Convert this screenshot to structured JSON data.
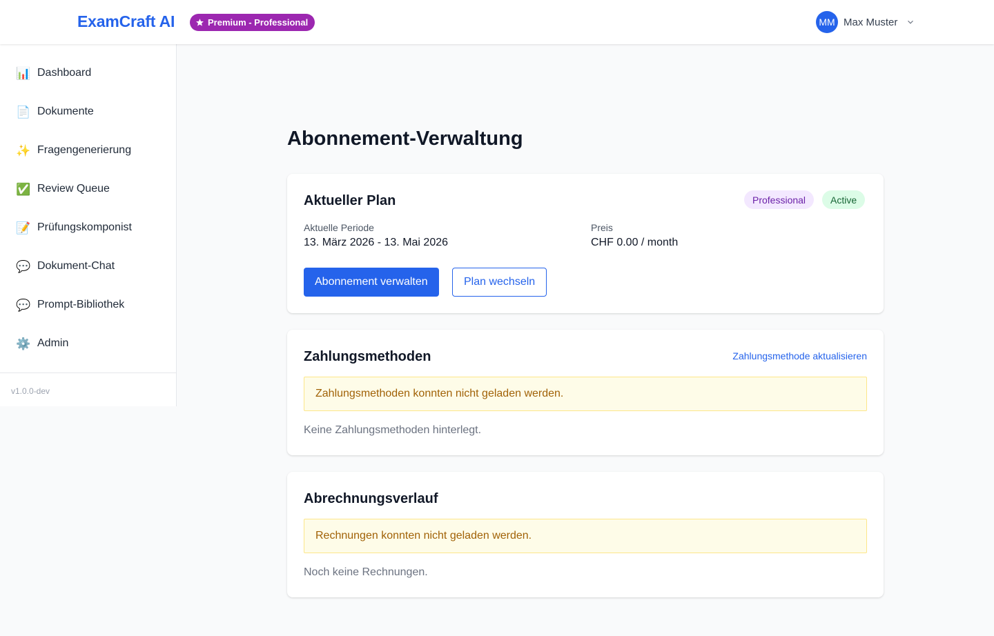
{
  "header": {
    "brand": "ExamCraft AI",
    "plan_badge": "Premium - Professional",
    "user": {
      "initials": "MM",
      "name": "Max Muster"
    }
  },
  "sidebar": {
    "items": [
      {
        "label": "Dashboard",
        "icon": "bar-chart-icon",
        "glyph": "📊"
      },
      {
        "label": "Dokumente",
        "icon": "document-icon",
        "glyph": "📄"
      },
      {
        "label": "Fragengenerierung",
        "icon": "sparkles-icon",
        "glyph": "✨"
      },
      {
        "label": "Review Queue",
        "icon": "check-mark-icon",
        "glyph": "✅"
      },
      {
        "label": "Prüfungskomponist",
        "icon": "memo-icon",
        "glyph": "📝"
      },
      {
        "label": "Dokument-Chat",
        "icon": "speech-bubble-icon",
        "glyph": "💬"
      },
      {
        "label": "Prompt-Bibliothek",
        "icon": "speech-bubble-icon",
        "glyph": "💬"
      },
      {
        "label": "Admin",
        "icon": "gear-icon",
        "glyph": "⚙️"
      }
    ],
    "version": "v1.0.0-dev"
  },
  "main": {
    "title": "Abonnement-Verwaltung",
    "current_plan": {
      "title": "Aktueller Plan",
      "plan_badge": "Professional",
      "status_badge": "Active",
      "period_label": "Aktuelle Periode",
      "period_value": "13. März 2026 - 13. Mai 2026",
      "price_label": "Preis",
      "price_value": "CHF 0.00 / month",
      "manage_button": "Abonnement verwalten",
      "change_button": "Plan wechseln"
    },
    "payment_methods": {
      "title": "Zahlungsmethoden",
      "update_link": "Zahlungsmethode aktualisieren",
      "warning": "Zahlungsmethoden konnten nicht geladen werden.",
      "empty": "Keine Zahlungsmethoden hinterlegt."
    },
    "billing_history": {
      "title": "Abrechnungsverlauf",
      "warning": "Rechnungen konnten nicht geladen werden.",
      "empty": "Noch keine Rechnungen."
    }
  },
  "colors": {
    "brand": "#2563eb",
    "premium": "#9c27b0",
    "warning_bg": "#fefce8",
    "warning_text": "#a16207"
  }
}
